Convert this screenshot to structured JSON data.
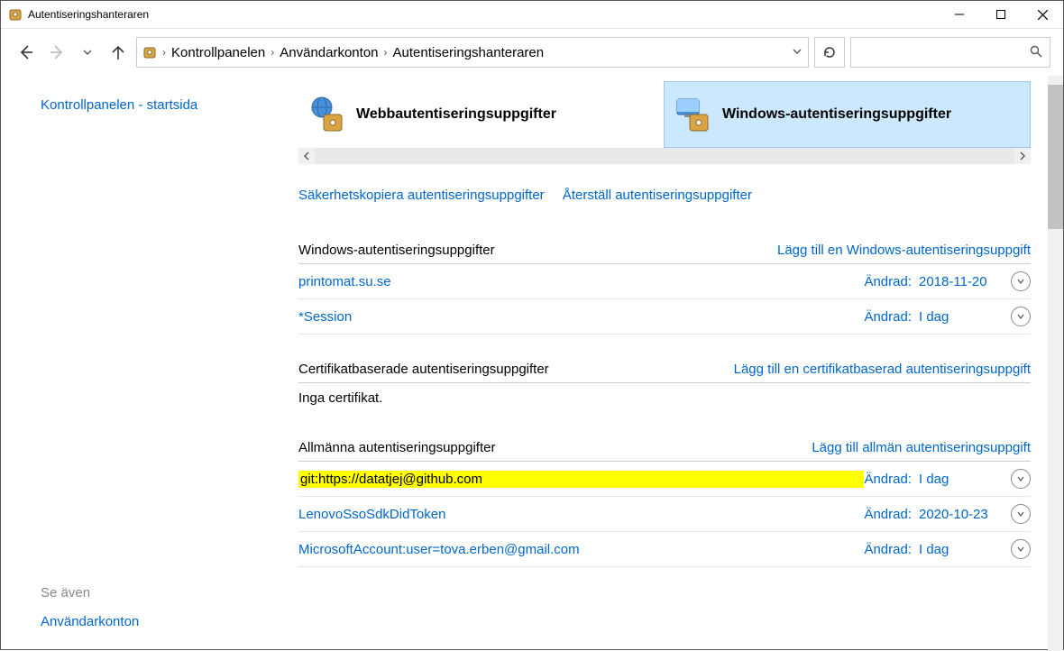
{
  "window": {
    "title": "Autentiseringshanteraren"
  },
  "breadcrumb": {
    "items": [
      "Kontrollpanelen",
      "Användarkonton",
      "Autentiseringshanteraren"
    ]
  },
  "leftpane": {
    "home_link": "Kontrollpanelen - startsida",
    "see_also_label": "Se även",
    "see_also_item": "Användarkonton"
  },
  "tabs": {
    "web": "Webbautentiseringsuppgifter",
    "windows": "Windows-autentiseringsuppgifter"
  },
  "actions": {
    "backup": "Säkerhetskopiera autentiseringsuppgifter",
    "restore": "Återställ autentiseringsuppgifter"
  },
  "sections": {
    "windows": {
      "title": "Windows-autentiseringsuppgifter",
      "add": "Lägg till en Windows-autentiseringsuppgift",
      "items": [
        {
          "name": "printomat.su.se",
          "mod_label": "Ändrad:",
          "mod_date": "2018-11-20",
          "highlight": false
        },
        {
          "name": "*Session",
          "mod_label": "Ändrad:",
          "mod_date": "I dag",
          "highlight": false
        }
      ]
    },
    "cert": {
      "title": "Certifikatbaserade autentiseringsuppgifter",
      "add": "Lägg till en certifikatbaserad autentiseringsuppgift",
      "empty": "Inga certifikat."
    },
    "generic": {
      "title": "Allmänna autentiseringsuppgifter",
      "add": "Lägg till allmän autentiseringsuppgift",
      "items": [
        {
          "name": "git:https://datatjej@github.com",
          "mod_label": "Ändrad:",
          "mod_date": "I dag",
          "highlight": true
        },
        {
          "name": "LenovoSsoSdkDidToken",
          "mod_label": "Ändrad:",
          "mod_date": "2020-10-23",
          "highlight": false
        },
        {
          "name": "MicrosoftAccount:user=tova.erben@gmail.com",
          "mod_label": "Ändrad:",
          "mod_date": "I dag",
          "highlight": false
        }
      ]
    }
  }
}
